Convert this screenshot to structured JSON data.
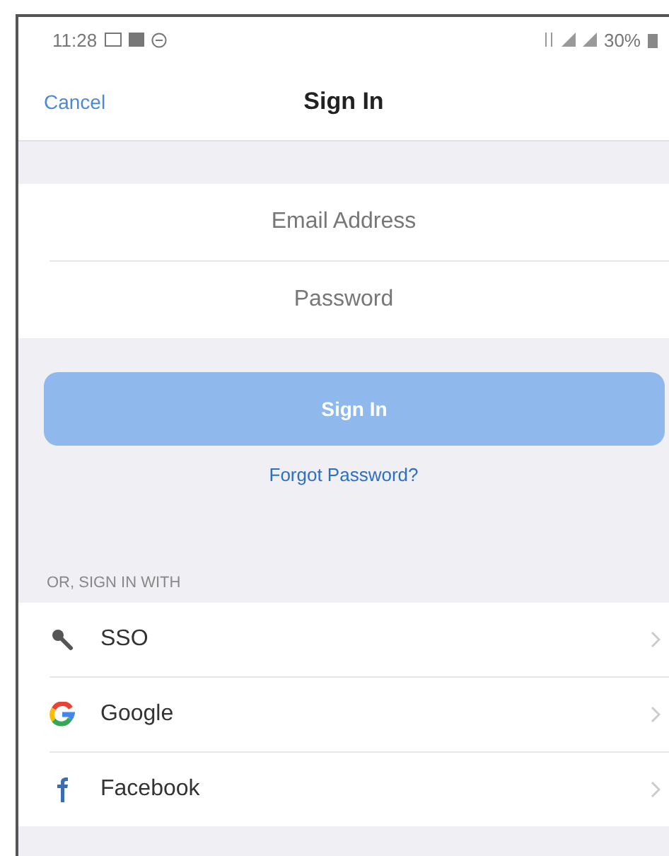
{
  "status_bar": {
    "time": "11:28",
    "battery": "30%"
  },
  "header": {
    "cancel": "Cancel",
    "title": "Sign In"
  },
  "fields": [
    {
      "placeholder": "Email Address"
    },
    {
      "placeholder": "Password"
    }
  ],
  "sign_in_button": {
    "label": "Sign In",
    "disabled": true
  },
  "forgot_link": "Forgot Password?",
  "section_label": "OR, SIGN IN WITH",
  "providers": [
    {
      "kind": "key",
      "label": "SSO"
    },
    {
      "kind": "google",
      "label": "Google"
    },
    {
      "kind": "facebook",
      "label": "Facebook"
    }
  ]
}
